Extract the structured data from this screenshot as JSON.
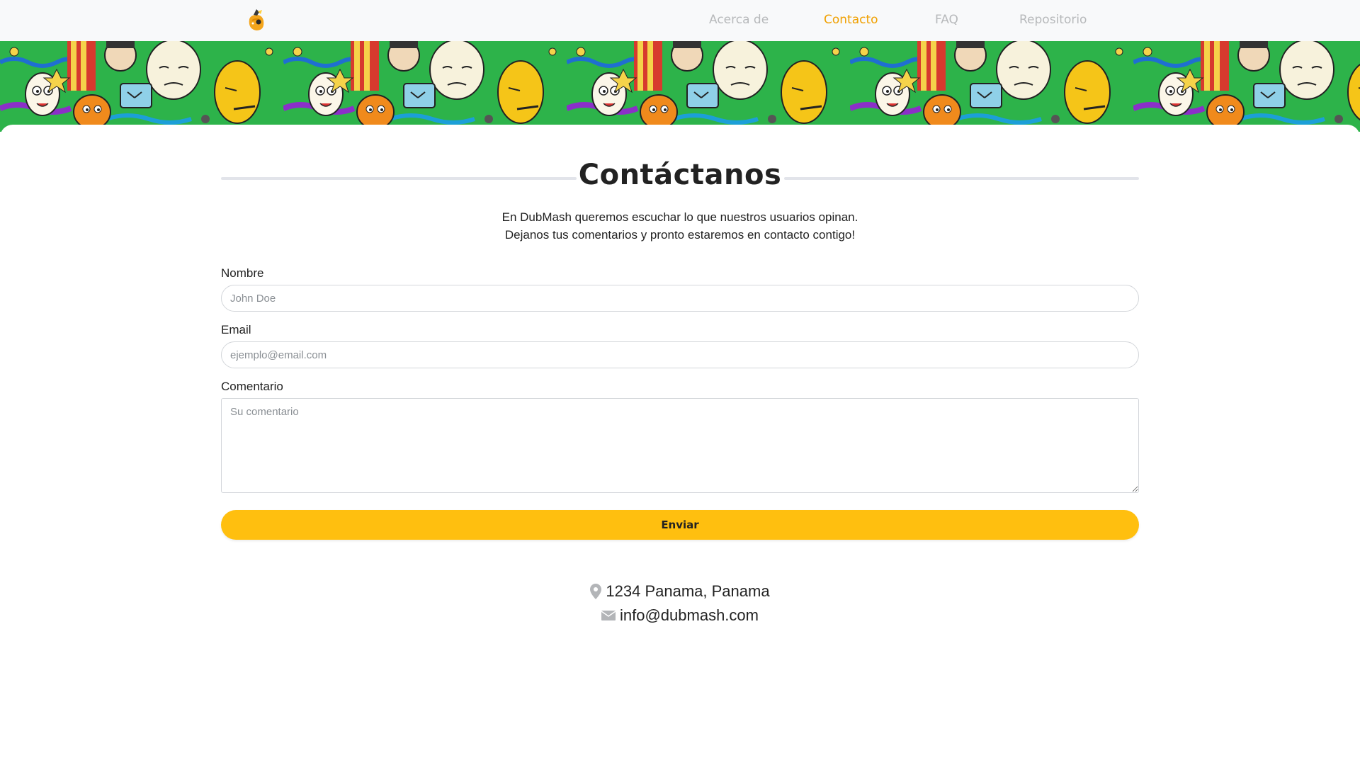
{
  "nav": {
    "logo_alt": "DubMash logo",
    "links": [
      {
        "label": "Acerca de",
        "active": false
      },
      {
        "label": "Contacto",
        "active": true
      },
      {
        "label": "FAQ",
        "active": false
      },
      {
        "label": "Repositorio",
        "active": false
      }
    ],
    "active_color": "#f0a000",
    "inactive_color": "#b7b9bb"
  },
  "banner": {
    "icon": "cartoon-faces-banner"
  },
  "contact": {
    "title": "Contáctanos",
    "intro_line_1": "En DubMash queremos escuchar lo que nuestros usuarios opinan.",
    "intro_line_2": "Dejanos tus comentarios y pronto estaremos en contacto contigo!",
    "form": {
      "name_label": "Nombre",
      "name_placeholder": "John Doe",
      "email_label": "Email",
      "email_placeholder": "ejemplo@email.com",
      "comment_label": "Comentario",
      "comment_placeholder": "Su comentario",
      "submit_label": "Enviar"
    },
    "address": "1234 Panama, Panama",
    "email": "info@dubmash.com",
    "address_icon": "map-pin-icon",
    "email_icon": "envelope-icon"
  },
  "colors": {
    "accent": "#ffbf0f",
    "navbar_bg": "#f8f9fa"
  }
}
